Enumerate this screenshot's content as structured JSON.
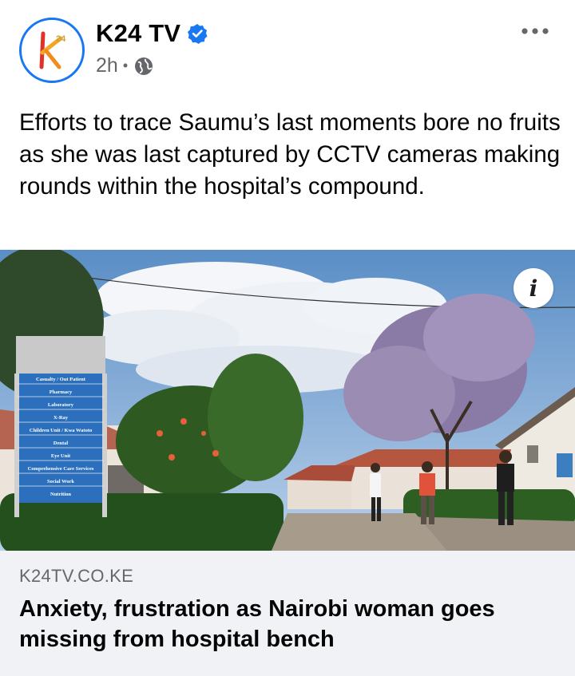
{
  "post": {
    "page_name": "K24 TV",
    "logo_text": "24",
    "time": "2h",
    "separator": "•",
    "body": "Efforts to trace Saumu’s last moments bore no fruits as she was last captured by CCTV cameras making rounds within the hospital’s compound."
  },
  "photo": {
    "info_label": "i",
    "sign_lines": [
      "Casualty / Out Patient",
      "Pharmacy",
      "Laboratory",
      "X-Ray",
      "Children Unit / Kwa Watoto",
      "Dental",
      "Eye Unit",
      "Comprehensive Care Services",
      "Social Work",
      "Nutrition"
    ]
  },
  "link": {
    "domain": "K24TV.CO.KE",
    "title": "Anxiety, frustration as Nairobi woman goes missing from hospital bench"
  },
  "icons": {
    "verified": "verified-badge-icon",
    "privacy": "globe-icon",
    "more": "more-options-icon",
    "info": "info-icon"
  },
  "colors": {
    "facebook_blue": "#1877f2",
    "secondary_text": "#65676b",
    "link_card_bg": "#f0f2f5",
    "logo_red": "#e0312a",
    "logo_orange": "#f5a623"
  }
}
